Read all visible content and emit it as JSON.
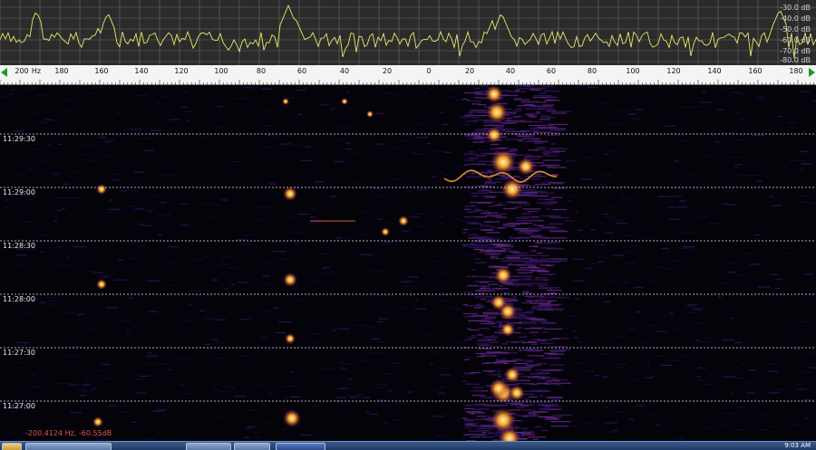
{
  "spectrum": {
    "db_labels": [
      "-30.0 dB",
      "-40.0 dB",
      "-50.0 dB",
      "-60.0 dB",
      "-70.0 dB",
      "-80.0 dB"
    ],
    "trace_color": "#e8e86a",
    "grid_color": "#6a6a6a"
  },
  "freq_scale": {
    "unit_label": "Hz",
    "labels": [
      "200",
      "180",
      "160",
      "140",
      "120",
      "100",
      "80",
      "60",
      "40",
      "20",
      "0",
      "20",
      "40",
      "60",
      "80",
      "100",
      "120",
      "140",
      "160",
      "180"
    ]
  },
  "waterfall": {
    "time_labels": [
      "11:29:30",
      "11:29:00",
      "11:28:30",
      "11:28:00",
      "11:27:30",
      "11:27:00"
    ],
    "cursor_readout": "-200.4124 Hz, -60.55dB"
  },
  "taskbar": {
    "clock": "9:03 AM"
  },
  "icons": [
    "start-icon",
    "browser-icon",
    "explorer-icon",
    "app-icon"
  ]
}
